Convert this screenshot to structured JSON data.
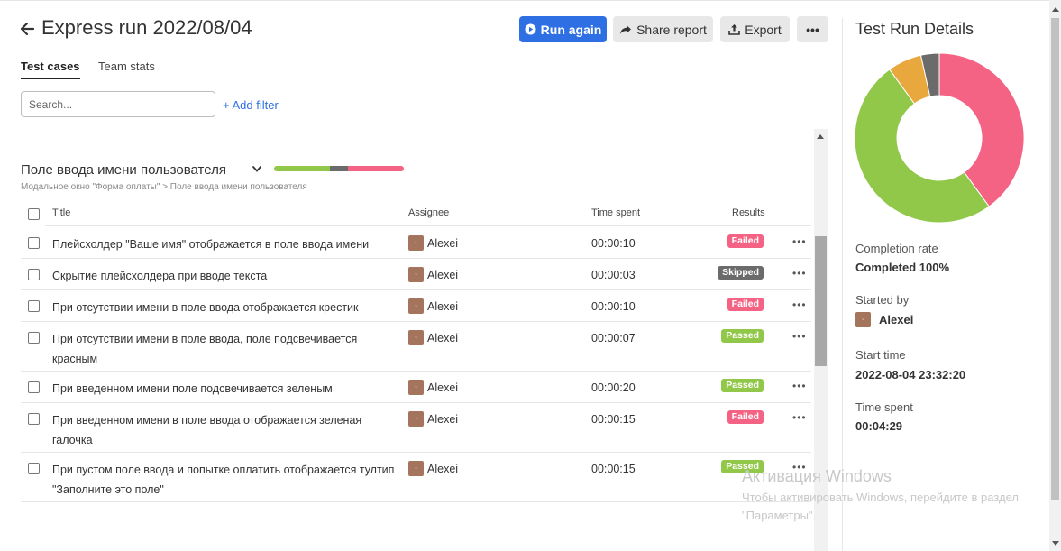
{
  "header": {
    "title": "Express run 2022/08/04",
    "run_again": "Run again",
    "share_report": "Share report",
    "export": "Export",
    "more": "•••"
  },
  "tabs": [
    {
      "label": "Test cases",
      "active": true
    },
    {
      "label": "Team stats",
      "active": false
    }
  ],
  "search": {
    "placeholder": "Search...",
    "value": ""
  },
  "add_filter": "+ Add filter",
  "section": {
    "title": "Поле ввода имени пользователя",
    "breadcrumb": "Модальное окно \"Форма оплаты\" > Поле ввода имени пользователя",
    "progress": {
      "passed": 3,
      "skipped": 1,
      "failed": 3
    }
  },
  "table": {
    "columns": [
      "Title",
      "Assignee",
      "Time spent",
      "Results"
    ],
    "rows": [
      {
        "title": "Плейсхолдер \"Ваше имя\" отображается в поле ввода имени",
        "assignee": "Alexei",
        "time": "00:00:10",
        "result": "Failed"
      },
      {
        "title": "Скрытие плейсхолдера при вводе текста",
        "assignee": "Alexei",
        "time": "00:00:03",
        "result": "Skipped"
      },
      {
        "title": "При отсутствии имени в поле ввода отображается крестик",
        "assignee": "Alexei",
        "time": "00:00:10",
        "result": "Failed"
      },
      {
        "title": "При отсутствии имени в поле ввода, поле подсвечивается красным",
        "assignee": "Alexei",
        "time": "00:00:07",
        "result": "Passed"
      },
      {
        "title": "При введенном имени поле подсвечивается зеленым",
        "assignee": "Alexei",
        "time": "00:00:20",
        "result": "Passed"
      },
      {
        "title": "При введенном имени в поле ввода отображается зеленая галочка",
        "assignee": "Alexei",
        "time": "00:00:15",
        "result": "Failed"
      },
      {
        "title": "При пустом поле ввода и попытке оплатить отображается тултип \"Заполните это поле\"",
        "assignee": "Alexei",
        "time": "00:00:15",
        "result": "Passed"
      }
    ]
  },
  "details": {
    "title": "Test Run Details",
    "completion_label": "Completion rate",
    "completion_value": "Completed 100%",
    "started_by_label": "Started by",
    "started_by_value": "Alexei",
    "start_time_label": "Start time",
    "start_time_value": "2022-08-04 23:32:20",
    "time_spent_label": "Time spent",
    "time_spent_value": "00:04:29",
    "donut": [
      {
        "status": "failed",
        "fraction": 0.4,
        "color": "#f46384"
      },
      {
        "status": "passed",
        "fraction": 0.5,
        "color": "#92c84a"
      },
      {
        "status": "blocked",
        "fraction": 0.065,
        "color": "#e8a83e"
      },
      {
        "status": "skipped",
        "fraction": 0.035,
        "color": "#6b6b6b"
      }
    ]
  },
  "colors": {
    "passed": "#92c84a",
    "failed": "#f46384",
    "skipped": "#6b6b6b",
    "accent": "#2f6fe4"
  },
  "watermark": {
    "title": "Активация Windows",
    "text": "Чтобы активировать Windows, перейдите в раздел \"Параметры\"."
  }
}
